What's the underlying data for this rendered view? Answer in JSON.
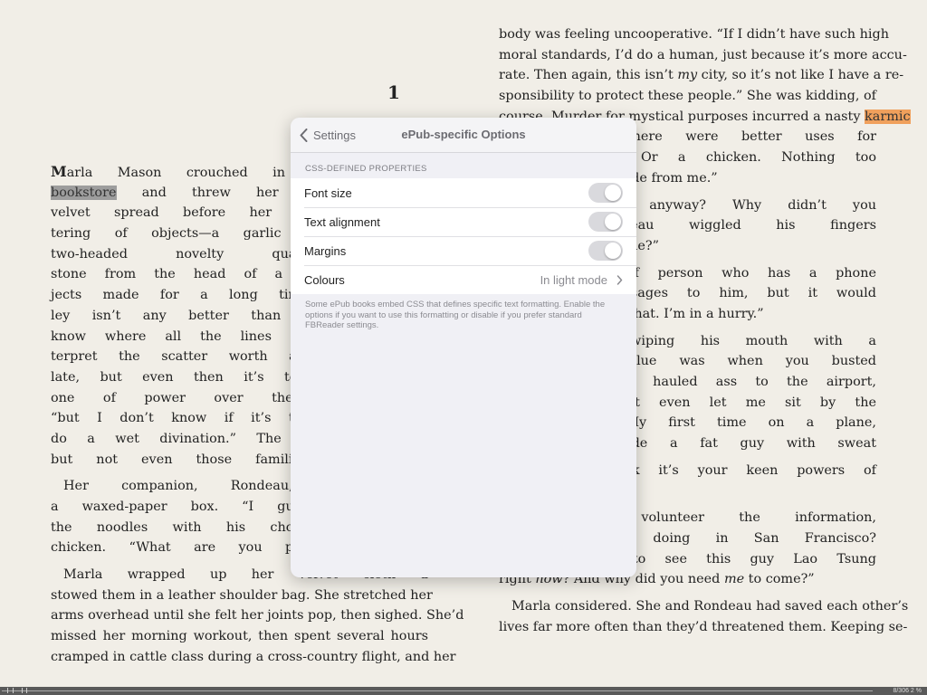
{
  "chapter_number": "1",
  "left_page": {
    "lines": [
      [
        "",
        "arla Mason crouched in the alley be"
      ],
      [
        "bookstore",
        " and threw her runes. The s"
      ],
      [
        "velvet spread before her on the ground"
      ],
      [
        "tering of objects—a garlic clove, a with"
      ],
      [
        "two-headed novelty quarter, fingerna"
      ],
      [
        "stone from the head of a toad. She studi"
      ],
      [
        "jects made for a long time, then sighed"
      ],
      [
        "ley isn’t any better than the other two"
      ],
      [
        "know where all the lines of force are in"
      ],
      [
        "terpret the scatter worth a damn. I tho"
      ],
      [
        "late, but even then it’s too vague. There"
      ],
      [
        "one of power over there”—she gesture"
      ],
      [
        "“but I don’t know if it’s the guy we’re l"
      ],
      [
        "do a wet divination.” The air smelled fai"
      ],
      [
        "but not even those familiar urban smell"
      ]
    ],
    "dropcap": "M",
    "highlight_word": "bookstore",
    "para2": [
      "Her companion, Rondeau, stood slurp",
      "a waxed-paper box. “I guess guts never",
      "the noodles with his chopstick and plu",
      "chicken. “What are you planning to evis"
    ],
    "para3": [
      "Marla wrapped up her velvet cloth a",
      "stowed them in a leather shoulder bag. She stretched her",
      "arms overhead until she felt her joints pop, then sighed. She’d",
      "missed her morning workout, then spent several hours",
      "cramped in cattle class during a cross-country flight, and her"
    ]
  },
  "right_page": {
    "para1": [
      "body was feeling uncooperative. “If I didn’t have such high",
      "moral standards, I’d do a human, just because it’s more accu-",
      "rate. Then again, this isn’t ",
      "sponsibility to protect these people.” She was kidding, of",
      "course. Murder for mystical purposes incurred a nasty ",
      "eful besides. There were better uses for",
      "A cat, maybe. Or a chicken. Nothing too",
      "Tsung is trying to hide from me.”"
    ],
    "rate_tail_em": "my",
    "rate_tail": " city, so it’s not like I have a re-",
    "highlight_word": "karmic",
    "para2": [
      "look for him anyway? Why didn’t you",
      "coming?” Rondeau wiggled his fingers",
      "er hear of a telephone?”"
    ],
    "para3": [
      "not the kind of person who has a phone",
      "ys to get messages to him, but it would",
      "ere wasn’t time for that. I’m in a hurry.”"
    ],
    "para4": [
      "ondeau said, wiping his mouth with a",
      "nk my first clue was when you busted",
      "to pack a bag, hauled ass to the airport,",
      "plane. You didn’t even let me sit by the",
      "s aggrieved. “My first time on a plane,",
      "he middle beside a fat guy with sweat"
    ],
    "para5": [
      "at, too? I think it’s your keen powers of",
      "ost.”"
    ],
    "para6": [
      "oping you’d volunteer the information,",
      "-what are we doing in San Francisco?",
      "hat you have to see this guy Lao Tsung"
    ],
    "para6_end_a": "right ",
    "para6_end_em1": "now",
    "para6_end_b": "? And why did you need ",
    "para6_end_em2": "me",
    "para6_end_c": " to come?”",
    "para7": [
      "Marla considered. She and Rondeau had saved each other’s",
      "lives far more often than they’d threatened them. Keeping se-"
    ]
  },
  "popover": {
    "back_label": "Settings",
    "title": "ePub-specific Options",
    "section_header": "CSS-DEFINED PROPERTIES",
    "rows": [
      {
        "label": "Font size",
        "enabled": false
      },
      {
        "label": "Text alignment",
        "enabled": false
      },
      {
        "label": "Margins",
        "enabled": false
      }
    ],
    "colours_label": "Colours",
    "colours_value": "In light mode",
    "footer_note": "Some ePub books embed CSS that defines specific text formatting. Enable the options if you want to use this formatting or disable if you prefer standard FBReader settings."
  },
  "bottom_bar": {
    "page_counter": "8/306 2 %"
  }
}
